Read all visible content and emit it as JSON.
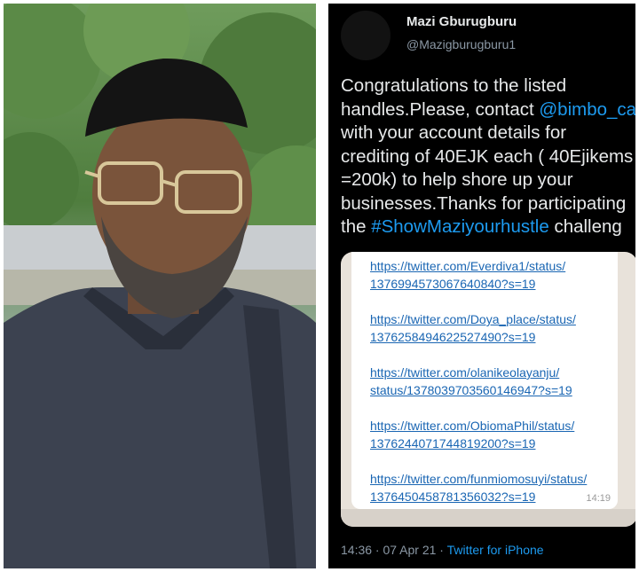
{
  "tweet": {
    "display_name": "Mazi Gburugburu",
    "handle": "@Mazigburugburu1",
    "body": {
      "l1": "Congratulations to the listed",
      "l2a": "handles.Please, contact ",
      "l2_mention": "@bimbo_ca",
      "l3": "with your account details for",
      "l4": "crediting of 40EJK each ( 40Ejikems",
      "l5": "=200k) to help shore up your",
      "l6": "businesses.Thanks for participating",
      "l7a": "the ",
      "l7_hashtag": "#ShowMaziyourhustle",
      "l7b": " challeng"
    },
    "embedded_message": {
      "links": [
        {
          "a": "https://twitter.com/Everdiva1/status/",
          "b": "1376994573067640840?s=19"
        },
        {
          "a": "https://twitter.com/Doya_place/status/",
          "b": "1376258494622527490?s=19"
        },
        {
          "a": "https://twitter.com/olanikeolayanju/",
          "b": "status/1378039703560146947?s=19"
        },
        {
          "a": "https://twitter.com/ObiomaPhil/status/",
          "b": "1376244071744819200?s=19"
        },
        {
          "a": "https://twitter.com/funmiomosuyi/status/",
          "b": "1376450458781356032?s=19"
        }
      ],
      "time": "14:19"
    },
    "meta": {
      "time_date": "14:36 · 07 Apr 21 · ",
      "source": "Twitter for iPhone"
    }
  },
  "colors": {
    "tweet_bg": "#000000",
    "link_blue": "#1d9bf0",
    "text": "#e7e9ea",
    "muted": "#8b98a5"
  },
  "photo": {
    "subject": "portrait of a man wearing a black cap and glasses"
  }
}
